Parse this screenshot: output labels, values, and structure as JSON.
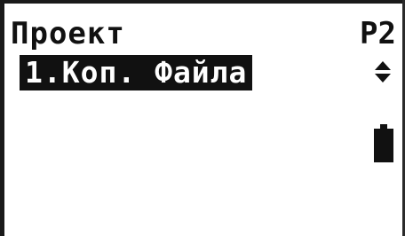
{
  "screen": {
    "title": "Проект",
    "page_indicator": "P2"
  },
  "menu": {
    "items": [
      {
        "label": "1.Коп. Файла",
        "selected": true
      }
    ]
  },
  "icons": {
    "scroll": "up-down-arrows-icon",
    "battery": "battery-icon"
  },
  "colors": {
    "background": "#ffffff",
    "text": "#111111",
    "highlight_bg": "#111111",
    "highlight_text": "#ffffff"
  }
}
